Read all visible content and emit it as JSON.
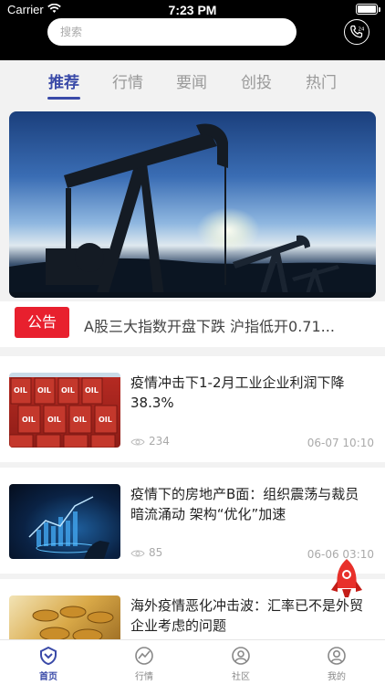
{
  "status_bar": {
    "carrier": "Carrier",
    "time": "7:23 PM"
  },
  "search": {
    "placeholder": "搜索"
  },
  "tabs": [
    {
      "label": "推荐",
      "active": true
    },
    {
      "label": "行情"
    },
    {
      "label": "要闻"
    },
    {
      "label": "创投"
    },
    {
      "label": "热门"
    }
  ],
  "notice": {
    "tag": "公告",
    "text": "A股三大指数开盘下跌 沪指低开0.71..."
  },
  "news": [
    {
      "title": "疫情冲击下1-2月工业企业利润下降38.3%",
      "views": "234",
      "date": "06-07 10:10"
    },
    {
      "title": "疫情下的房地产B面：组织震荡与裁员暗流涌动 架构“优化”加速",
      "views": "85",
      "date": "06-06 03:10"
    },
    {
      "title": "海外疫情恶化冲击波：汇率已不是外贸企业考虑的问题",
      "views": "",
      "date": ""
    }
  ],
  "bottom_nav": [
    {
      "label": "首页",
      "icon": "home-icon",
      "active": true
    },
    {
      "label": "行情",
      "icon": "market-icon"
    },
    {
      "label": "社区",
      "icon": "community-icon"
    },
    {
      "label": "我的",
      "icon": "profile-icon"
    }
  ],
  "colors": {
    "accent": "#3a4aa8",
    "notice_red": "#e8202e",
    "header_bg": "#000000"
  }
}
